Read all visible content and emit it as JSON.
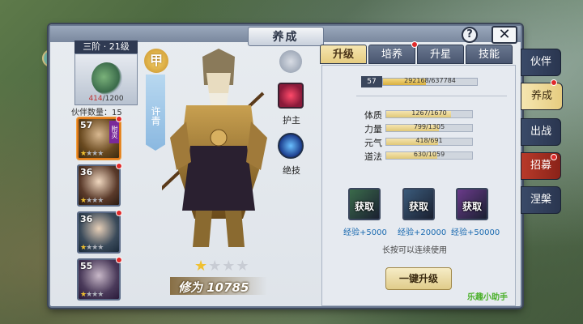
{
  "title": "养成",
  "help_label": "?",
  "close_label": "✕",
  "mount": {
    "rank": "三阶 · 21级",
    "exp_current": "414",
    "exp_total": "/1200"
  },
  "partner_count_label": "伙伴数量：15",
  "heroes": [
    {
      "level": "57",
      "stars": 1,
      "max_stars": 4,
      "tag": "附灵",
      "selected": true
    },
    {
      "level": "36",
      "stars": 1,
      "max_stars": 4,
      "tag": "",
      "selected": false
    },
    {
      "level": "36",
      "stars": 1,
      "max_stars": 4,
      "tag": "",
      "selected": false
    },
    {
      "level": "55",
      "stars": 1,
      "max_stars": 4,
      "tag": "",
      "selected": false
    }
  ],
  "hero": {
    "rank_badge": "甲",
    "name": "许青",
    "stars": 1,
    "max_stars": 4,
    "cultivation": "修为 10785",
    "skills": [
      {
        "label": "护主",
        "icon": "sword-emblem-icon"
      },
      {
        "label": "绝技",
        "icon": "crescent-slash-icon"
      }
    ]
  },
  "tabs": [
    "升级",
    "培养",
    "升星",
    "技能"
  ],
  "level": {
    "value": "57",
    "exp": "292168/637784",
    "progress": 0.458
  },
  "stats": [
    {
      "label": "体质",
      "value": "1267/1670",
      "ratio": 0.759
    },
    {
      "label": "力量",
      "value": "799/1305",
      "ratio": 0.612
    },
    {
      "label": "元气",
      "value": "418/691",
      "ratio": 0.605
    },
    {
      "label": "道法",
      "value": "630/1059",
      "ratio": 0.595
    }
  ],
  "books": [
    {
      "label": "获取",
      "exp": "经验+5000",
      "color": "#3a6a4a"
    },
    {
      "label": "获取",
      "exp": "经验+20000",
      "color": "#3a5a7a"
    },
    {
      "label": "获取",
      "exp": "经验+50000",
      "color": "#6a3a8a"
    }
  ],
  "hint": "长按可以连续使用",
  "upgrade_button": "一键升级",
  "watermark": "乐趣小助手",
  "side_nav": [
    "伙伴",
    "养成",
    "出战",
    "招募",
    "涅槃"
  ]
}
